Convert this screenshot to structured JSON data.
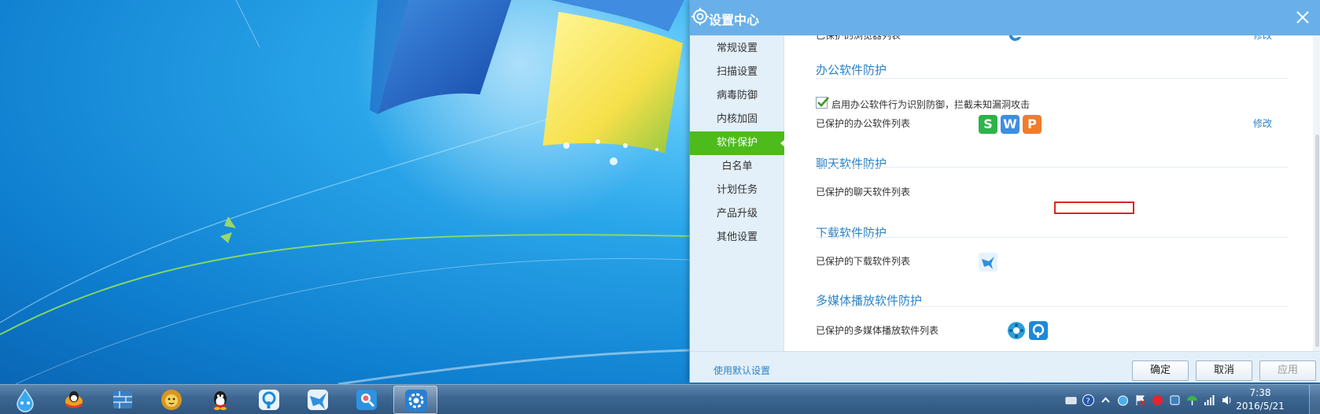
{
  "window": {
    "title": "设置中心",
    "title_icon": "gear-icon",
    "close_icon": "close-icon"
  },
  "sidebar": {
    "items": [
      {
        "label": "常规设置"
      },
      {
        "label": "扫描设置"
      },
      {
        "label": "病毒防御"
      },
      {
        "label": "内核加固"
      },
      {
        "label": "软件保护",
        "active": true
      },
      {
        "label": "白名单"
      },
      {
        "label": "计划任务"
      },
      {
        "label": "产品升级"
      },
      {
        "label": "其他设置"
      }
    ]
  },
  "content": {
    "partial_top_label": "已保护的浏览器列表",
    "partial_top_link": "修改",
    "office": {
      "title": "办公软件防护",
      "checkbox_label": "启用办公软件行为识别防御，拦截未知漏洞攻击",
      "checked": true,
      "list_label": "已保护的办公软件列表",
      "icons": [
        {
          "name": "wps-writer-icon",
          "letter": "S",
          "color": "#2eb34a"
        },
        {
          "name": "wps-word-icon",
          "letter": "W",
          "color": "#3b8fe3"
        },
        {
          "name": "wps-presentation-icon",
          "letter": "P",
          "color": "#f07d2b"
        }
      ],
      "modify_link": "修改"
    },
    "chat": {
      "title": "聊天软件防护",
      "list_label": "已保护的聊天软件列表"
    },
    "download": {
      "title": "下载软件防护",
      "list_label": "已保护的下载软件列表",
      "icons": [
        {
          "name": "xunlei-bird-icon"
        }
      ]
    },
    "media": {
      "title": "多媒体播放软件防护",
      "list_label": "已保护的多媒体播放软件列表",
      "icons": [
        {
          "name": "film-reel-icon"
        },
        {
          "name": "pptv-player-icon"
        }
      ]
    }
  },
  "footer": {
    "default_link": "使用默认设置",
    "ok": "确定",
    "cancel": "取消",
    "apply": "应用"
  },
  "taskbar": {
    "apps": [
      {
        "name": "droplet-app-icon"
      },
      {
        "name": "qq-penguin-app-icon"
      },
      {
        "name": "firewall-app-icon"
      },
      {
        "name": "lion-app-icon"
      },
      {
        "name": "qq-app-icon"
      },
      {
        "name": "pptv-app-icon"
      },
      {
        "name": "xunlei-app-icon"
      },
      {
        "name": "search-user-app-icon"
      },
      {
        "name": "settings-gear-app-icon",
        "active": true
      }
    ],
    "clock_time": "7:38",
    "clock_date": "2016/5/21"
  },
  "colors": {
    "accent_blue": "#69b0ea",
    "active_green": "#4dbb1c",
    "section_title": "#2c84c7",
    "highlight_red": "#e02424"
  }
}
